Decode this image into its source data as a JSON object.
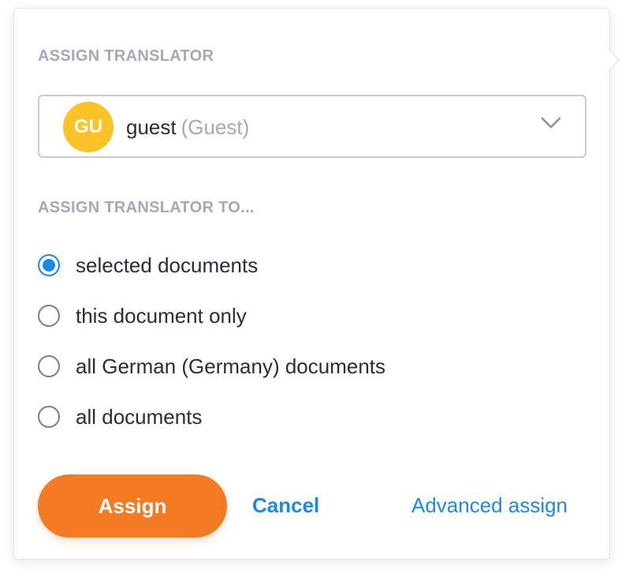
{
  "assign_translator": {
    "heading": "ASSIGN TRANSLATOR",
    "selected_user": {
      "avatar_initials": "GU",
      "avatar_color": "#fbc328",
      "name": "guest",
      "role": "(Guest)"
    },
    "dropdown_icon": "chevron-down-icon"
  },
  "assign_to": {
    "heading": "ASSIGN TRANSLATOR TO...",
    "options": [
      {
        "label": "selected documents",
        "checked": true
      },
      {
        "label": "this document only",
        "checked": false
      },
      {
        "label": "all German (Germany) documents",
        "checked": false
      },
      {
        "label": "all documents",
        "checked": false
      }
    ]
  },
  "actions": {
    "assign_label": "Assign",
    "cancel_label": "Cancel",
    "advanced_label": "Advanced assign"
  },
  "colors": {
    "accent_orange": "#f47a24",
    "link_blue": "#1e88e5",
    "label_gray": "#a8a6b8",
    "avatar_yellow": "#fbc328"
  }
}
